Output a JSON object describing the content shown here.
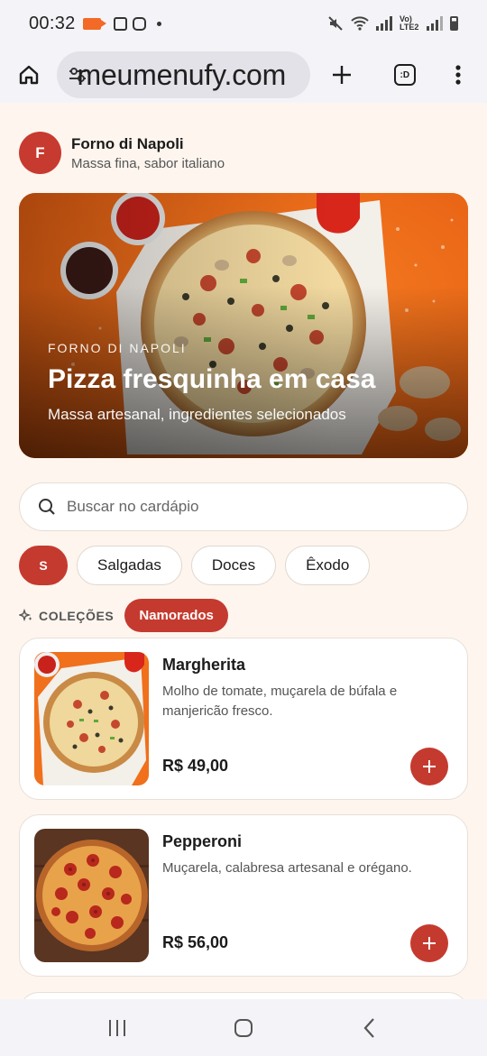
{
  "status_bar": {
    "time": "00:32",
    "network": "Vo) LTE2"
  },
  "browser": {
    "url": "meumenufy.com",
    "tab_badge": ":D"
  },
  "restaurant": {
    "initial": "F",
    "name": "Forno di Napoli",
    "tagline": "Massa fina, sabor italiano"
  },
  "hero": {
    "eyebrow": "FORNO DI NAPOLI",
    "title": "Pizza fresquinha em casa",
    "subtitle": "Massa artesanal, ingredientes selecionados"
  },
  "search": {
    "placeholder": "Buscar no cardápio"
  },
  "categories": [
    {
      "label": "S",
      "active": true
    },
    {
      "label": "Salgadas",
      "active": false
    },
    {
      "label": "Doces",
      "active": false
    },
    {
      "label": "Êxodo",
      "active": false
    }
  ],
  "collections": {
    "label": "COLEÇÕES",
    "selected": "Namorados"
  },
  "products": [
    {
      "name": "Margherita",
      "description": "Molho de tomate, muçarela de búfala e manjericão fresco.",
      "price": "R$ 49,00"
    },
    {
      "name": "Pepperoni",
      "description": "Muçarela, calabresa artesanal e orégano.",
      "price": "R$ 56,00"
    }
  ],
  "colors": {
    "accent": "#c53a2f",
    "background": "#fdf5ee",
    "hero_orange": "#f06a18"
  },
  "icons": [
    "home-icon",
    "site-settings-icon",
    "new-tab-icon",
    "tabs-icon",
    "more-menu-icon",
    "search-icon",
    "sparkle-icon",
    "add-icon",
    "recents-icon",
    "home-nav-icon",
    "back-icon"
  ]
}
